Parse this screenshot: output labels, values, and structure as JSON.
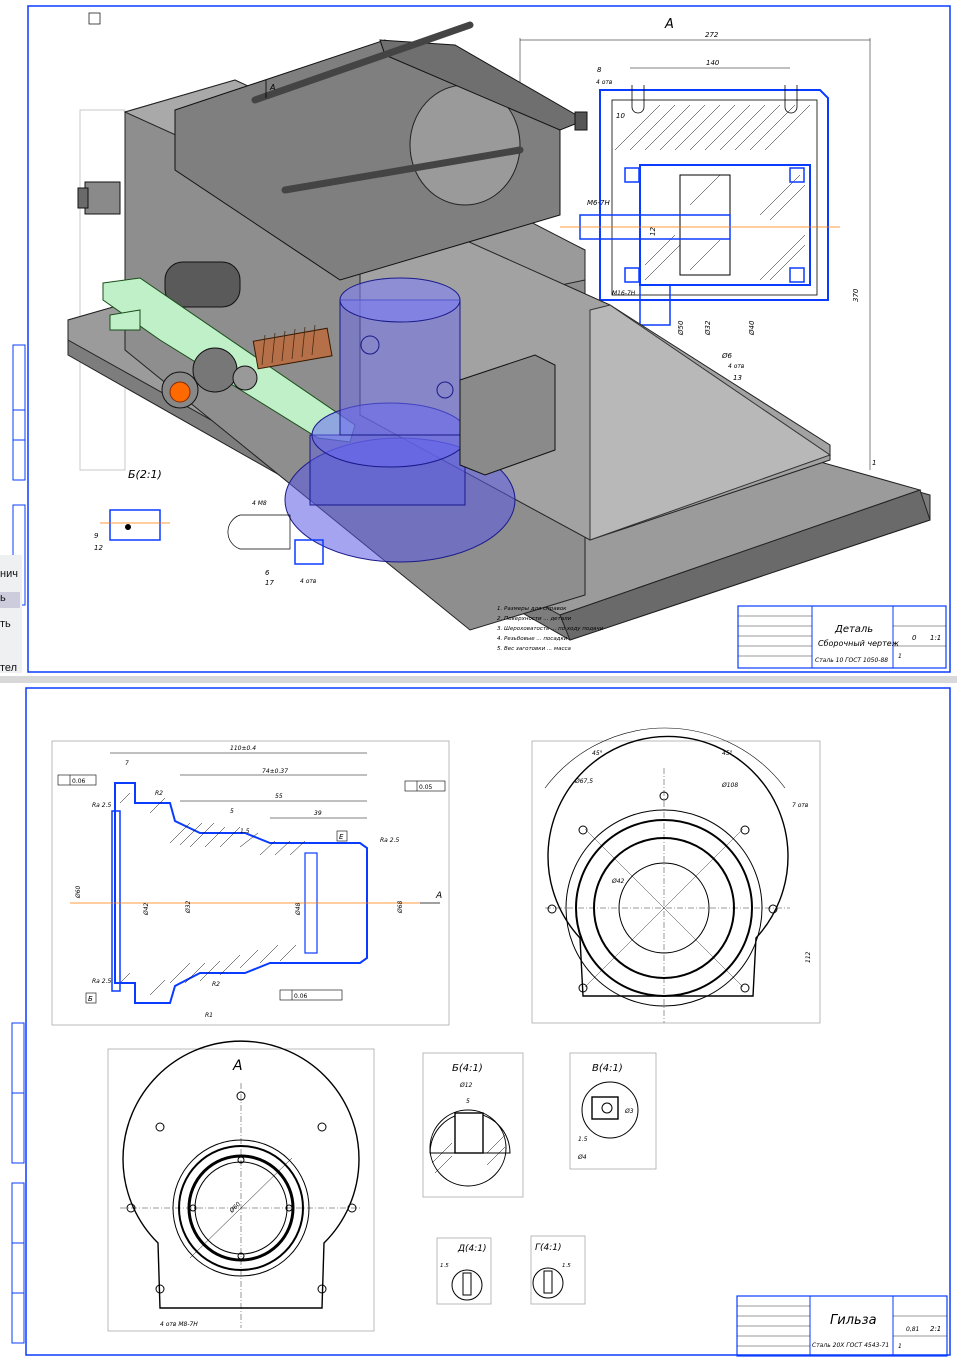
{
  "colors": {
    "frame": "#0a3cff",
    "ink": "#000000",
    "model_gray": "#8e8e8e",
    "handle_green": "#bff0c8",
    "transparent_blue": "#5a5ae6",
    "copper": "#b5704a",
    "accent_orange": "#ff6a00"
  },
  "sheet1": {
    "view_a_label": "А",
    "arrow_label": "А",
    "dims": [
      "272",
      "140",
      "8",
      "4 отв",
      "10",
      "М6-7Н",
      "12",
      "М16-7Н",
      "Ø32",
      "Ø40",
      "Ø50",
      "370",
      "Ø6",
      "4 отв",
      "1",
      "13"
    ],
    "detail_b": {
      "title": "Б(2:1)",
      "num": "9",
      "sub": "12"
    },
    "bottom_labels": {
      "ring": "4 М8",
      "num": "6",
      "sub": "17",
      "spec": "4 отв"
    },
    "notes": [
      "1. Размеры для справок",
      "2. Поверхности ... детали",
      "3. Шероховатость ... по ходу подачи",
      "4. Резьбовые ... посадки",
      "5. Вес заготовки ... масса"
    ],
    "title_block": {
      "name_line1": "Деталь",
      "name_line2": "Сборочный чертеж",
      "material": "Сталь 10 ГОСТ 1050-88",
      "scale": "1:1",
      "mass": "0",
      "sheet": "1"
    },
    "ui_fragments": [
      "нич",
      "ь",
      "ть",
      "тел"
    ]
  },
  "sheet2": {
    "section_dims": [
      "110±0.4",
      "74±0.37",
      "55",
      "39",
      "Ø60",
      "Ø42",
      "Ø32",
      "Ø48",
      "Ø68",
      "Ra 2.5",
      "R2",
      "R1",
      "7",
      "5",
      "1.5"
    ],
    "tolerance_frames": [
      "0.06",
      "0.05",
      "0.06"
    ],
    "datum_labels": [
      "Б",
      "Е",
      "А"
    ],
    "front_dims": [
      "45°",
      "45°",
      "Ø67,5",
      "Ø108",
      "7 отв",
      "Ø42",
      "112"
    ],
    "view_a": {
      "title": "А",
      "note": "4 отв М8-7Н",
      "dim": "Ø60"
    },
    "detail_b": {
      "title": "Б(4:1)",
      "dims": [
        "Ø12",
        "5"
      ]
    },
    "detail_v": {
      "title": "В(4:1)",
      "dims": [
        "1.5",
        "Ø3",
        "Ø4"
      ]
    },
    "detail_d": {
      "title": "Д(4:1)",
      "dims": [
        "1.5"
      ]
    },
    "detail_g": {
      "title": "Г(4:1)",
      "dims": [
        "1.5"
      ]
    },
    "title_block": {
      "name": "Гильза",
      "material": "Сталь 20Х ГОСТ 4543-71",
      "scale": "2:1",
      "mass": "0,81",
      "sheet": "1"
    }
  }
}
